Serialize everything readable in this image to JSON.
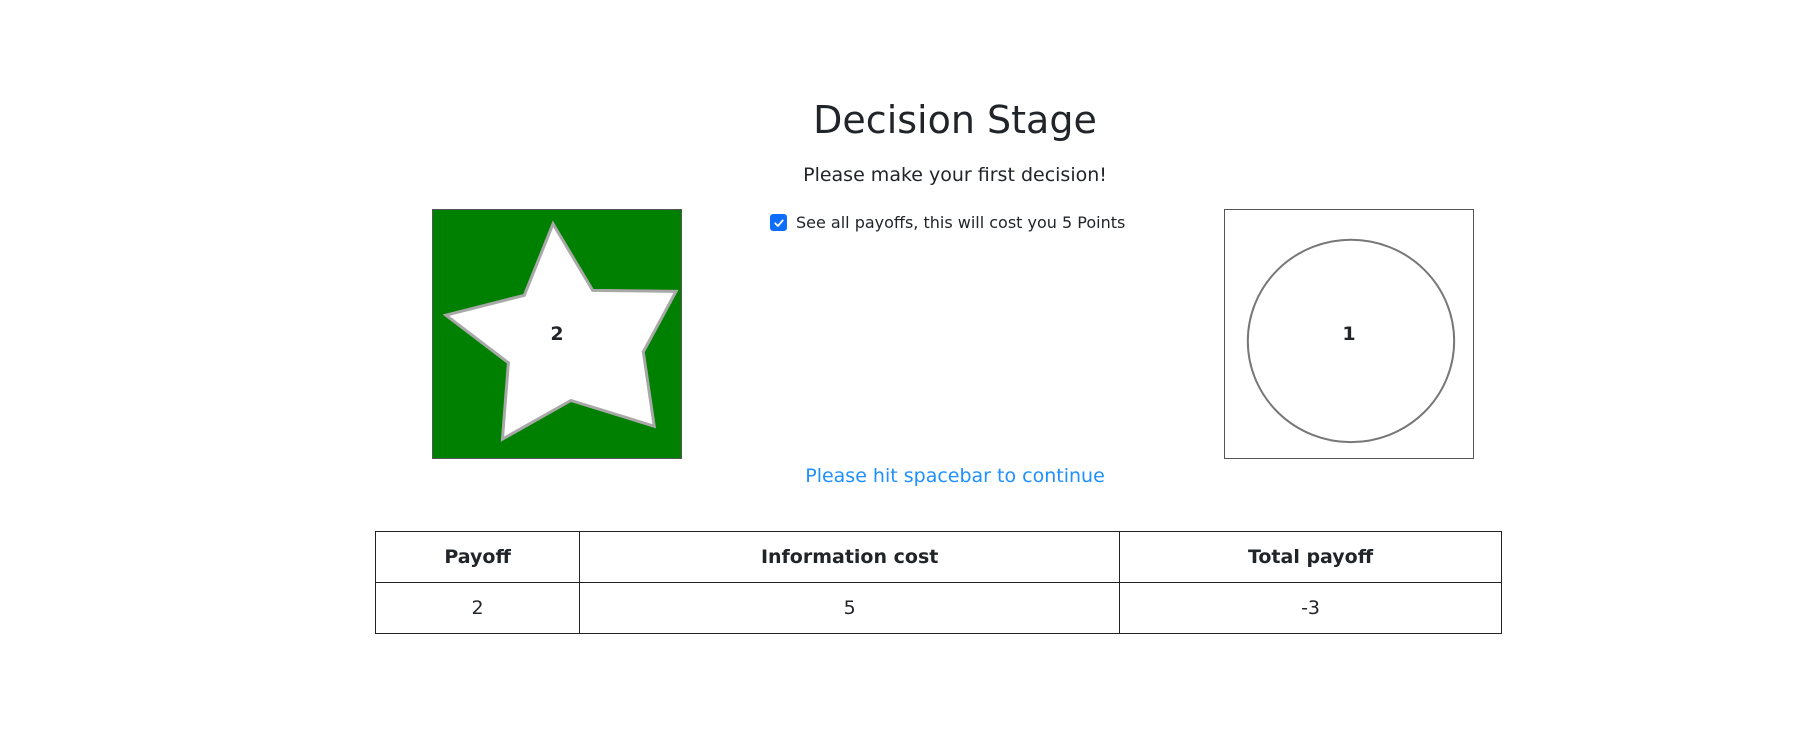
{
  "header": {
    "title": "Decision Stage",
    "subtitle": "Please make your first decision!"
  },
  "options": {
    "left": {
      "shape": "star",
      "value": "2",
      "background_color": "#008000",
      "shape_fill": "#ffffff",
      "shape_stroke": "#a8a8a8"
    },
    "right": {
      "shape": "circle",
      "value": "1",
      "background_color": "#ffffff",
      "shape_fill": "#ffffff",
      "shape_stroke": "#777777"
    }
  },
  "info_checkbox": {
    "label": "See all payoffs, this will cost you 5 Points",
    "checked": true,
    "checked_color": "#0d6efd"
  },
  "continue_hint": {
    "text": "Please hit spacebar to continue",
    "color": "#1e90ff"
  },
  "payoff_table": {
    "columns": [
      "Payoff",
      "Information cost",
      "Total payoff"
    ],
    "rows": [
      [
        "2",
        "5",
        "-3"
      ]
    ]
  }
}
